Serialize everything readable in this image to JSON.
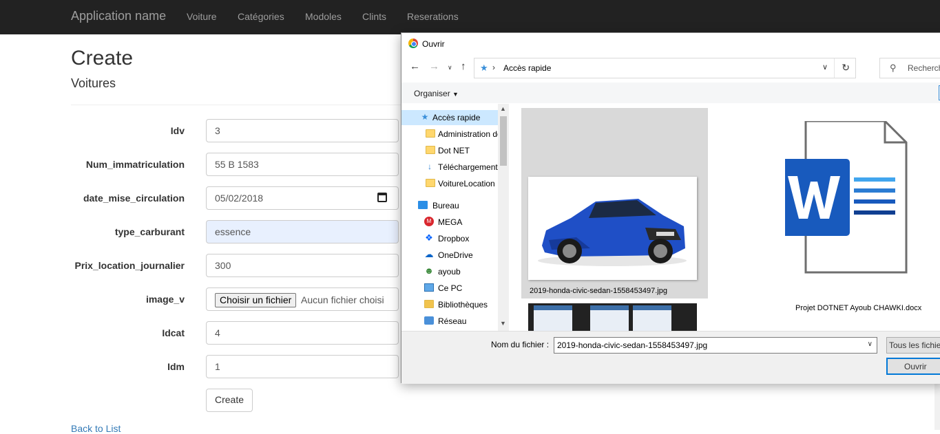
{
  "navbar": {
    "brand": "Application name",
    "links": [
      "Voiture",
      "Catégories",
      "Modoles",
      "Clints",
      "Reserations"
    ]
  },
  "page": {
    "title": "Create",
    "subtitle": "Voitures",
    "fields": [
      {
        "label": "Idv",
        "value": "3"
      },
      {
        "label": "Num_immatriculation",
        "value": "55 B 1583"
      },
      {
        "label": "date_mise_circulation",
        "value": "05/02/2018"
      },
      {
        "label": "type_carburant",
        "value": "essence"
      },
      {
        "label": "Prix_location_journalier",
        "value": "300"
      },
      {
        "label": "image_v",
        "button": "Choisir un fichier",
        "status": "Aucun fichier choisi"
      },
      {
        "label": "Idcat",
        "value": "4"
      },
      {
        "label": "Idm",
        "value": "1"
      }
    ],
    "create_button": "Create",
    "back_link": "Back to List"
  },
  "dialog": {
    "title": "Ouvrir",
    "address": "Accès rapide",
    "search_placeholder": "Rechercher",
    "organiser": "Organiser",
    "nav_items": [
      {
        "label": "Accès rapide",
        "icon": "star-icon"
      },
      {
        "label": "Administration des",
        "icon": "folder-icon"
      },
      {
        "label": "Dot NET",
        "icon": "folder-icon"
      },
      {
        "label": "Téléchargements",
        "icon": "download-icon"
      },
      {
        "label": "VoitureLocation",
        "icon": "folder-icon"
      },
      {
        "label": "Bureau",
        "icon": "desktop-icon"
      },
      {
        "label": "MEGA",
        "icon": "mega-icon"
      },
      {
        "label": "Dropbox",
        "icon": "dropbox-icon"
      },
      {
        "label": "OneDrive",
        "icon": "cloud-icon"
      },
      {
        "label": "ayoub",
        "icon": "user-icon"
      },
      {
        "label": "Ce PC",
        "icon": "computer-icon"
      },
      {
        "label": "Bibliothèques",
        "icon": "library-icon"
      },
      {
        "label": "Réseau",
        "icon": "network-icon"
      }
    ],
    "files": [
      {
        "name": "2019-honda-civic-sedan-1558453497.jpg",
        "selected": true
      },
      {
        "name": "Projet DOTNET Ayoub CHAWKI.docx",
        "selected": false
      }
    ],
    "filename_label": "Nom du fichier :",
    "filename_value": "2019-honda-civic-sedan-1558453497.jpg",
    "filter": "Tous les fichiers",
    "open_button": "Ouvrir",
    "colors": {
      "accent": "#0078d7",
      "selection": "#cce8ff",
      "word_blue": "#185abd"
    }
  }
}
